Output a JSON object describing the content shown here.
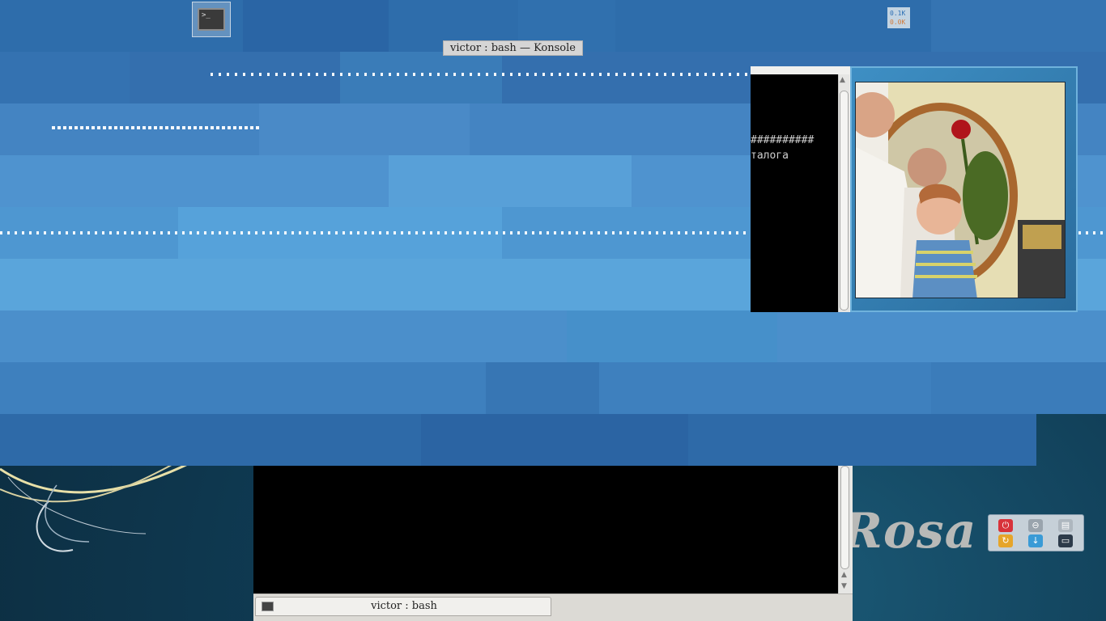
{
  "desktop": {
    "launcher_icon": "terminal-icon",
    "launcher_glyph": ">_",
    "brand": "Rosa"
  },
  "net_monitor": {
    "upload": "0.1K",
    "download": "0.0K"
  },
  "window_title_tip": "victor : bash — Konsole",
  "terminal_fragment": {
    "line1": "##########",
    "line2": "талога"
  },
  "konsole": {
    "tab_label": "victor : bash",
    "tab_icon": "terminal-icon"
  },
  "tray": {
    "buttons": [
      "power-icon",
      "lock-icon",
      "sleep-icon",
      "restart-icon",
      "download-icon",
      "display-icon"
    ]
  },
  "colors": {
    "accent": "#4a8cc8",
    "terminal_bg": "#000000",
    "brand_text": "#b8b9b7"
  }
}
